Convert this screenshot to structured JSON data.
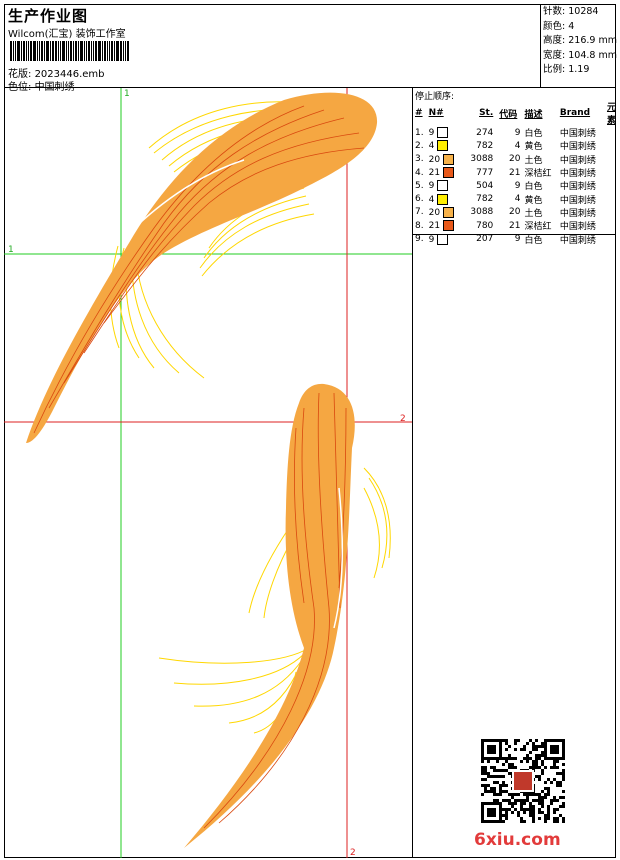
{
  "header": {
    "title": "生产作业图",
    "studio": "Wilcom(汇宝) 装饰工作室",
    "design_label": "花版:",
    "design_value": "2023446.emb",
    "colorway_label": "色位:",
    "colorway_value": "中国刺绣"
  },
  "specs": [
    {
      "label": "针数:",
      "value": "10284"
    },
    {
      "label": "颜色:",
      "value": "4"
    },
    {
      "label": "高度:",
      "value": "216.9 mm"
    },
    {
      "label": "宽度:",
      "value": "104.8 mm"
    },
    {
      "label": "比例:",
      "value": "1.19"
    }
  ],
  "stop_sequence": {
    "title": "停止顺序:",
    "columns": [
      "#",
      "N#",
      "St.",
      "代码",
      "描述",
      "Brand",
      "元素"
    ],
    "rows": [
      {
        "idx": "1.",
        "n": "9",
        "color": "#ffffff",
        "st": "274",
        "code": "9",
        "desc": "白色",
        "brand": "中国刺绣"
      },
      {
        "idx": "2.",
        "n": "4",
        "color": "#ffee00",
        "st": "782",
        "code": "4",
        "desc": "黄色",
        "brand": "中国刺绣"
      },
      {
        "idx": "3.",
        "n": "20",
        "color": "#f7b24a",
        "st": "3088",
        "code": "20",
        "desc": "土色",
        "brand": "中国刺绣"
      },
      {
        "idx": "4.",
        "n": "21",
        "color": "#e8591a",
        "st": "777",
        "code": "21",
        "desc": "深桔红",
        "brand": "中国刺绣"
      },
      {
        "idx": "5.",
        "n": "9",
        "color": "#ffffff",
        "st": "504",
        "code": "9",
        "desc": "白色",
        "brand": "中国刺绣"
      },
      {
        "idx": "6.",
        "n": "4",
        "color": "#ffee00",
        "st": "782",
        "code": "4",
        "desc": "黄色",
        "brand": "中国刺绣"
      },
      {
        "idx": "7.",
        "n": "20",
        "color": "#f7b24a",
        "st": "3088",
        "code": "20",
        "desc": "土色",
        "brand": "中国刺绣"
      },
      {
        "idx": "8.",
        "n": "21",
        "color": "#e8591a",
        "st": "780",
        "code": "21",
        "desc": "深桔红",
        "brand": "中国刺绣"
      },
      {
        "idx": "9.",
        "n": "9",
        "color": "#ffffff",
        "st": "207",
        "code": "9",
        "desc": "白色",
        "brand": "中国刺绣"
      }
    ]
  },
  "guides": {
    "green_v": "1",
    "green_h": "1",
    "red_v": "2",
    "red_h": "2"
  },
  "watermark": "6xiu.com",
  "colors": {
    "guide_green": "#22cc22",
    "guide_red": "#dd2222",
    "fish_body": "#f5a742",
    "fish_stripe": "#d9480f",
    "fin": "#ffd700"
  }
}
